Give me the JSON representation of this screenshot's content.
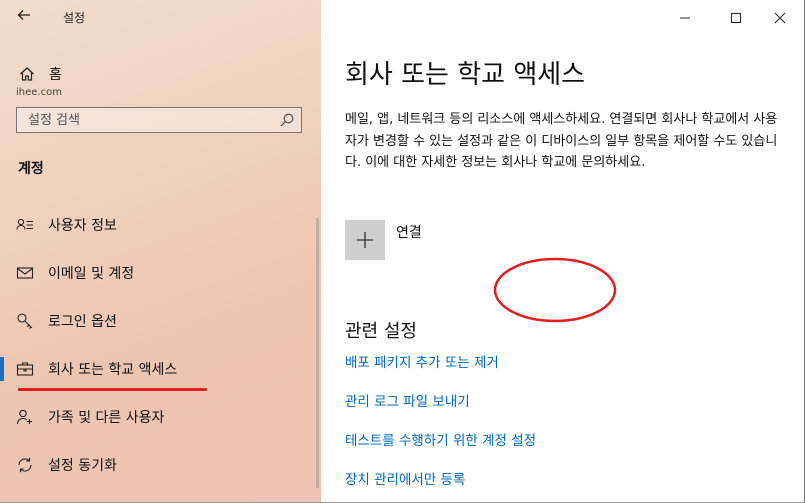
{
  "app": {
    "title": "설정"
  },
  "sidebar": {
    "home_label": "홈",
    "watermark": "ihee.com",
    "search_placeholder": "설정 검색",
    "section_title": "계정",
    "items": [
      {
        "label": "사용자 정보",
        "icon": "user-info-icon"
      },
      {
        "label": "이메일 및 계정",
        "icon": "mail-icon"
      },
      {
        "label": "로그인 옵션",
        "icon": "key-icon"
      },
      {
        "label": "회사 또는 학교 액세스",
        "icon": "briefcase-icon",
        "active": true
      },
      {
        "label": "가족 및 다른 사용자",
        "icon": "add-user-icon"
      },
      {
        "label": "설정 동기화",
        "icon": "sync-icon"
      }
    ]
  },
  "main": {
    "title": "회사 또는 학교 액세스",
    "description": "메일, 앱, 네트워크 등의 리소스에 액세스하세요. 연결되면 회사나 학교에서 사용자가 변경할 수 있는 설정과 같은 이 디바이스의 일부 항목을 제어할 수도 있습니다. 이에 대한 자세한 정보는 회사나 학교에 문의하세요.",
    "connect_label": "연결",
    "related_title": "관련 설정",
    "links": [
      "배포 패키지 추가 또는 제거",
      "관리 로그 파일 보내기",
      "테스트를 수행하기 위한 계정 설정",
      "장치 관리에서만 등록"
    ]
  },
  "colors": {
    "accent": "#0067b8",
    "active_indicator": "#1a6fc4",
    "annotation_red": "#e02020"
  }
}
